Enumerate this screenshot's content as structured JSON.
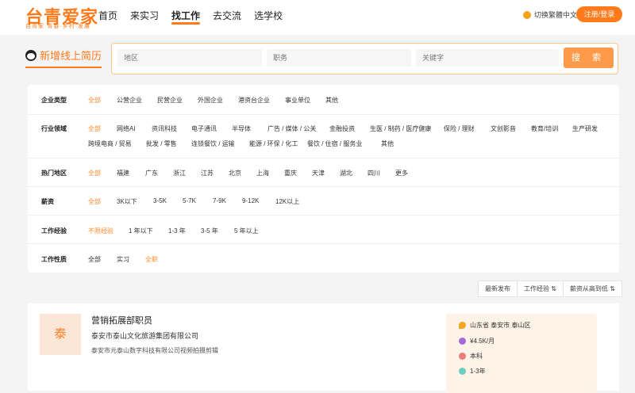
{
  "header": {
    "logo_title": "台青爱家",
    "logo_sub": "台青家·青春·乡村·发展",
    "nav": [
      "首页",
      "来实习",
      "找工作",
      "去交流",
      "选学校"
    ],
    "lang_label": "切换繁體中文",
    "login_label": "注册/登录"
  },
  "resume": {
    "label": "新增线上简历"
  },
  "search": {
    "area_placeholder": "地区",
    "job_placeholder": "职务",
    "keyword_placeholder": "关键字",
    "button_label": "搜 索"
  },
  "filters": {
    "company_type": {
      "label": "企业类型",
      "options": [
        "全部",
        "公营企业",
        "民营企业",
        "外国企业",
        "港资台企业",
        "事业单位",
        "其他"
      ]
    },
    "industry": {
      "label": "行业领域",
      "options": [
        "全部",
        "网络AI",
        "资讯科技",
        "电子通讯",
        "半导体",
        "广告 / 媒体 / 公关",
        "金融投资",
        "生医 / 制药 / 医疗健康",
        "保险 / 理财",
        "文创影音",
        "教育/培训",
        "生产研发",
        "跨境电商 / 贸易",
        "批发 / 零售",
        "连锁餐饮 / 运输",
        "能源 / 环保 / 化工",
        "餐饮 / 住宿 / 服务业",
        "其他"
      ]
    },
    "region": {
      "label": "热门地区",
      "options": [
        "全部",
        "福建",
        "广东",
        "浙江",
        "江苏",
        "北京",
        "上海",
        "重庆",
        "天津",
        "湖北",
        "四川",
        "更多"
      ]
    },
    "salary": {
      "label": "薪资",
      "options": [
        "全部",
        "3K以下",
        "3-5K",
        "5-7K",
        "7-9K",
        "9-12K",
        "12K以上"
      ]
    },
    "experience": {
      "label": "工作经验",
      "options": [
        "不限经验",
        "1 年以下",
        "1-3 年",
        "3-5 年",
        "5 年以上"
      ]
    },
    "job_nature": {
      "label": "工作性质",
      "options": [
        "全部",
        "实习",
        "全职"
      ]
    }
  },
  "sort": [
    "最新发布",
    "工作经验 ⇅",
    "薪资从高到低 ⇅"
  ],
  "job": {
    "avatar_char": "泰",
    "title": "营销拓展部职员",
    "company": "泰安市泰山文化旅游集团有限公司",
    "subcompany": "泰安市元泰山数字科技有限公司视频拍摄剪辑",
    "location": "山东省 泰安市 泰山区",
    "salary": "¥4.5K/月",
    "education": "本科",
    "experience": "1-3年"
  },
  "colors": {
    "accent": "#ff7a1a",
    "accent_light": "#ff9a4a",
    "panel_bg": "#fdf3e6"
  }
}
